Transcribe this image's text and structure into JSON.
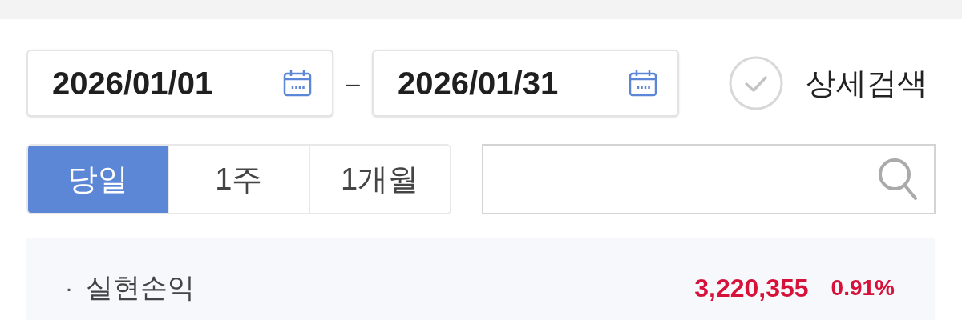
{
  "date_range": {
    "start": "2026/01/01",
    "separator": "–",
    "end": "2026/01/31"
  },
  "detail_search": {
    "label": "상세검색",
    "checked": false
  },
  "period_tabs": [
    {
      "label": "당일",
      "selected": true
    },
    {
      "label": "1주",
      "selected": false
    },
    {
      "label": "1개월",
      "selected": false
    }
  ],
  "summary": [
    {
      "bullet": "·",
      "label": "실현손익",
      "amount": "3,220,355",
      "rate": "0.91%"
    }
  ]
}
